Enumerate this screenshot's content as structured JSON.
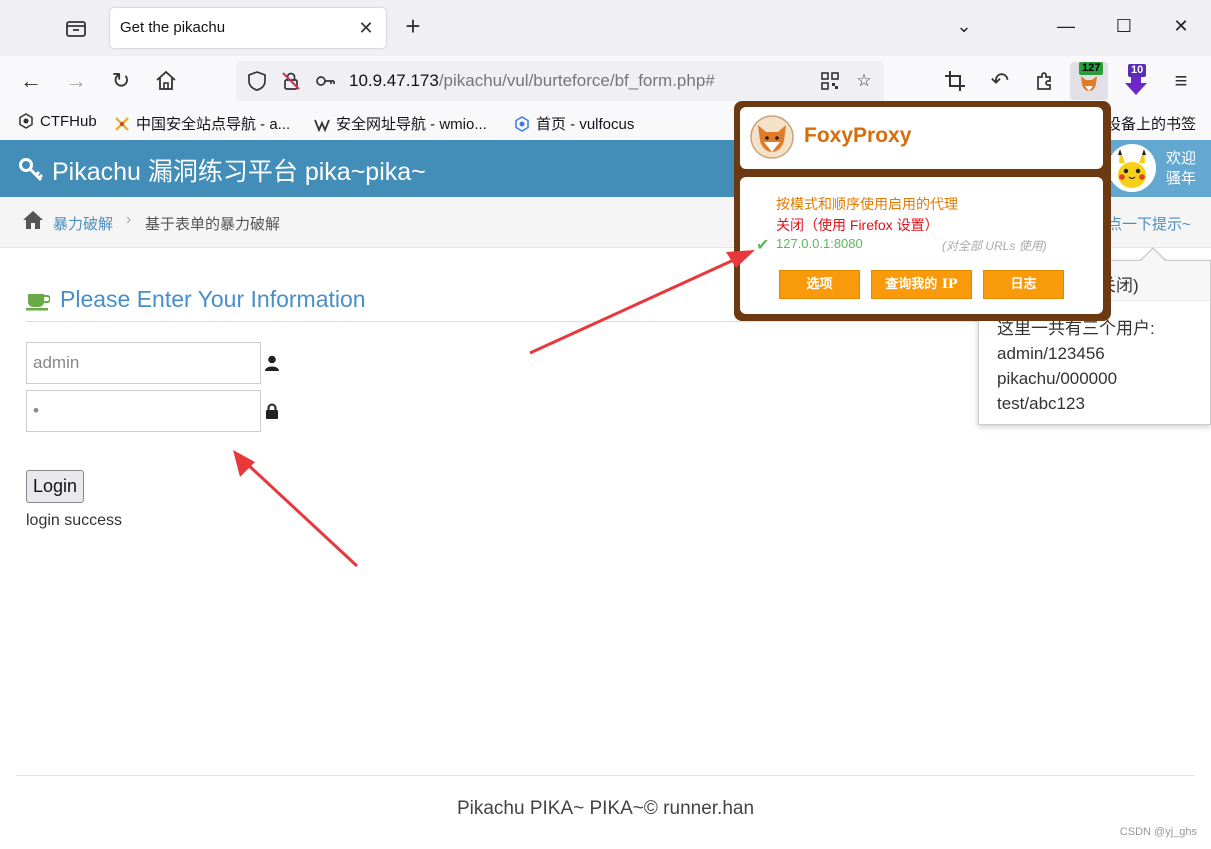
{
  "browser": {
    "tab_title": "Get the pikachu",
    "url_host": "10.9.47.173",
    "url_path": "/pikachu/vul/burteforce/bf_form.php#",
    "ext_badge_1": "127",
    "ext_badge_2": "10",
    "bookmarks": [
      {
        "label": "CTFHub"
      },
      {
        "label": "中国安全站点导航 - a..."
      },
      {
        "label": "安全网址导航 - wmio..."
      },
      {
        "label": "首页 - vulfocus"
      },
      {
        "label": "设备上的书签"
      }
    ]
  },
  "header": {
    "title": "Pikachu 漏洞练习平台 pika~pika~",
    "user_line1": "欢迎",
    "user_line2": "骚年"
  },
  "breadcrumb": {
    "link": "暴力破解",
    "current": "基于表单的暴力破解",
    "hint": "点一下提示~"
  },
  "form": {
    "title": "Please Enter Your Information",
    "username_value": "admin",
    "password_value": "•",
    "login_label": "Login",
    "message": "login success"
  },
  "popover": {
    "head": "关闭)",
    "lines": [
      "这里一共有三个用户:",
      "admin/123456",
      "pikachu/000000",
      "test/abc123"
    ]
  },
  "foxyproxy": {
    "name": "FoxyProxy",
    "mode_patterns": "按模式和顺序使用启用的代理",
    "mode_off": "关闭（使用 Firefox 设置）",
    "proxy": "127.0.0.1:8080",
    "proxy_note": "(对全部 URLs 使用)",
    "buttons": [
      "选项",
      "查询我的 IP",
      "日志"
    ],
    "colors": {
      "frame": "#6b3a12",
      "brand": "#d76d0a",
      "button": "#f99a0b",
      "mode": "#e07b00",
      "off": "#e0121b",
      "active": "#5cb85c"
    }
  },
  "footer": {
    "text": "Pikachu PIKA~ PIKA~© runner.han",
    "watermark": "CSDN @yj_ghs"
  },
  "colors": {
    "header": "#438eb9",
    "link": "#4c8fbd",
    "title": "#478fca"
  }
}
